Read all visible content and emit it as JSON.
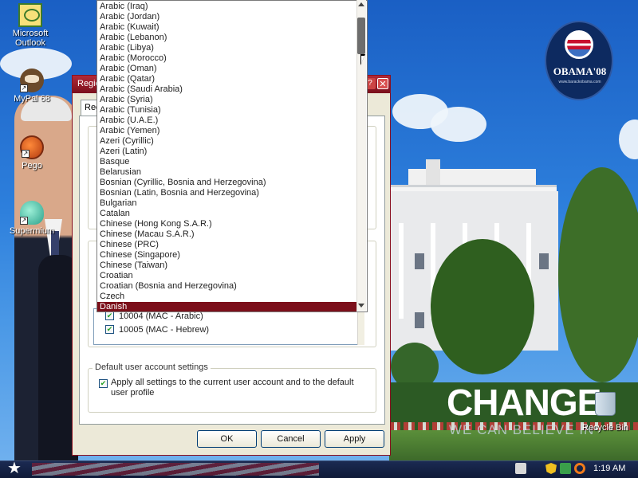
{
  "desktop": {
    "icons": [
      {
        "label": "Microsoft Outlook"
      },
      {
        "label": "MyPal 68"
      },
      {
        "label": "Pego"
      },
      {
        "label": "Supermium"
      }
    ],
    "recycle_bin_label": "Recycle Bin",
    "wallpaper": {
      "headline": "CHANGE",
      "tagline": "WE CAN BELIEVE IN",
      "logo_text": "OBAMA'08",
      "logo_url": "www.barackobama.com"
    }
  },
  "dialog": {
    "title": "Regio",
    "tab_label": "Reg",
    "code_pages": [
      {
        "label": "10004 (MAC - Arabic)",
        "checked": true
      },
      {
        "label": "10005 (MAC - Hebrew)",
        "checked": true
      }
    ],
    "account_group_label": "Default user account settings",
    "account_option_label": "Apply all settings to the current user account and to the default user profile",
    "account_option_checked": true,
    "buttons": {
      "ok": "OK",
      "cancel": "Cancel",
      "apply": "Apply"
    },
    "help_glyph": "?",
    "close_glyph": "✕"
  },
  "language_dropdown": {
    "items": [
      "Arabic (Iraq)",
      "Arabic (Jordan)",
      "Arabic (Kuwait)",
      "Arabic (Lebanon)",
      "Arabic (Libya)",
      "Arabic (Morocco)",
      "Arabic (Oman)",
      "Arabic (Qatar)",
      "Arabic (Saudi Arabia)",
      "Arabic (Syria)",
      "Arabic (Tunisia)",
      "Arabic (U.A.E.)",
      "Arabic (Yemen)",
      "Azeri (Cyrillic)",
      "Azeri (Latin)",
      "Basque",
      "Belarusian",
      "Bosnian (Cyrillic, Bosnia and Herzegovina)",
      "Bosnian (Latin, Bosnia and Herzegovina)",
      "Bulgarian",
      "Catalan",
      "Chinese (Hong Kong S.A.R.)",
      "Chinese (Macau S.A.R.)",
      "Chinese (PRC)",
      "Chinese (Singapore)",
      "Chinese (Taiwan)",
      "Croatian",
      "Croatian (Bosnia and Herzegovina)",
      "Czech",
      "Danish"
    ],
    "selected": "Danish"
  },
  "taskbar": {
    "start_glyph": "★",
    "clock": "1:19 AM"
  },
  "colors": {
    "selection": "#7c0f1a",
    "titlebar": "#9a1b29",
    "taskbar": "#15224a"
  }
}
